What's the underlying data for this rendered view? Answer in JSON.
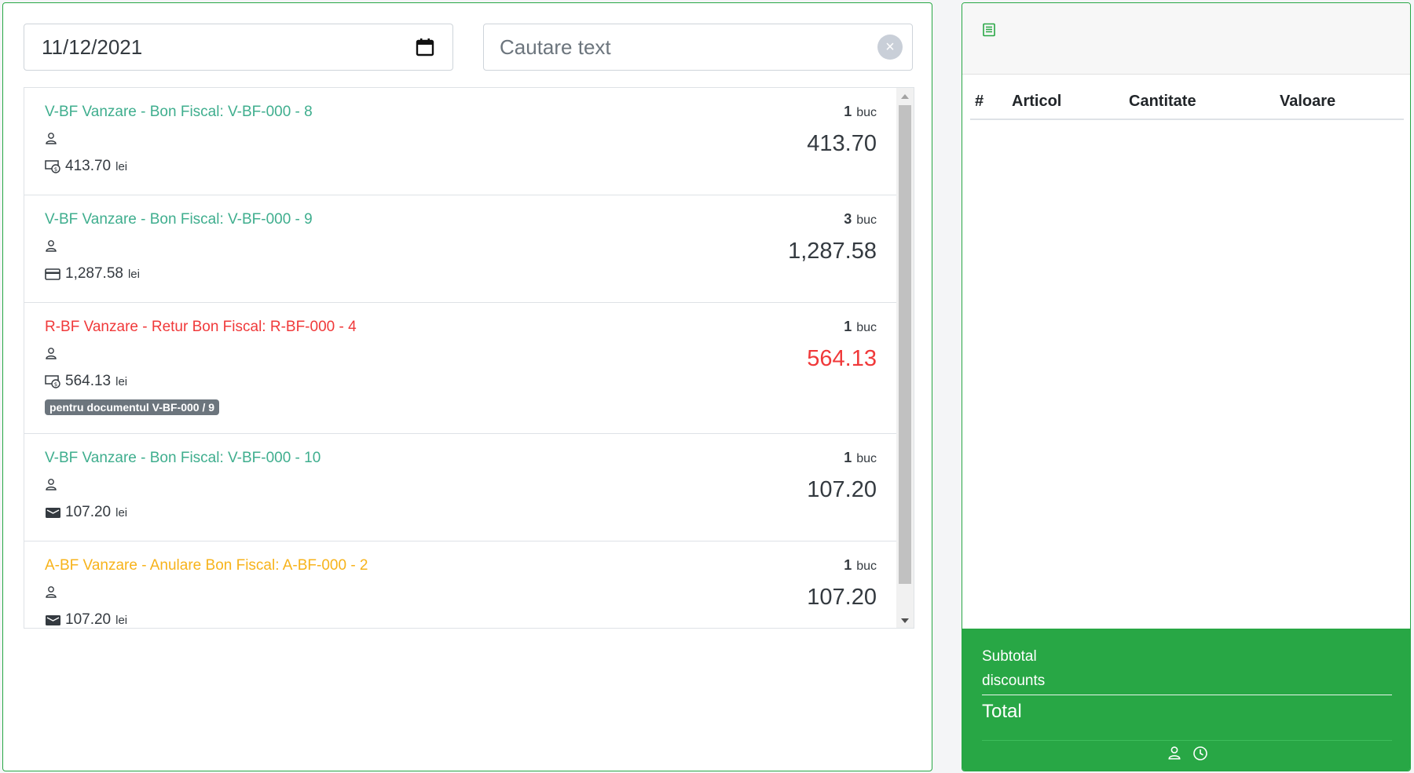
{
  "filters": {
    "date_value": "11/12/2021",
    "search_placeholder": "Cautare text",
    "clear_symbol": "×"
  },
  "documents": [
    {
      "title": "V-BF Vanzare - Bon Fiscal: V-BF-000 - 8",
      "status_color": "green",
      "payment_icon": "cash-icon",
      "payment_amount": "413.70",
      "currency": "lei",
      "quantity": "1",
      "quantity_unit": "buc",
      "total": "413.70"
    },
    {
      "title": "V-BF Vanzare - Bon Fiscal: V-BF-000 - 9",
      "status_color": "green",
      "payment_icon": "card-icon",
      "payment_amount": "1,287.58",
      "currency": "lei",
      "quantity": "3",
      "quantity_unit": "buc",
      "total": "1,287.58"
    },
    {
      "title": "R-BF Vanzare - Retur Bon Fiscal: R-BF-000 - 4",
      "status_color": "red",
      "payment_icon": "cash-icon",
      "payment_amount": "564.13",
      "currency": "lei",
      "quantity": "1",
      "quantity_unit": "buc",
      "total": "564.13",
      "reference_badge": "pentru documentul  V-BF-000 / 9"
    },
    {
      "title": "V-BF Vanzare - Bon Fiscal: V-BF-000 - 10",
      "status_color": "green",
      "payment_icon": "wallet-icon",
      "payment_amount": "107.20",
      "currency": "lei",
      "quantity": "1",
      "quantity_unit": "buc",
      "total": "107.20"
    },
    {
      "title": "A-BF Vanzare - Anulare Bon Fiscal: A-BF-000 - 2",
      "status_color": "orange",
      "payment_icon": "wallet-icon",
      "payment_amount": "107.20",
      "currency": "lei",
      "quantity": "1",
      "quantity_unit": "buc",
      "total": "107.20"
    }
  ],
  "detail": {
    "header_icon": "receipt-icon",
    "columns": [
      "#",
      "Articol",
      "Cantitate",
      "Valoare"
    ],
    "subtotal_label": "Subtotal",
    "discounts_label": "discounts",
    "total_label": "Total",
    "footer_icons": [
      "user-icon",
      "clock-icon"
    ]
  },
  "colors": {
    "accent_green": "#28a745",
    "title_green": "#3fae8e",
    "title_red": "#f0393a",
    "title_orange": "#f7b31b"
  }
}
